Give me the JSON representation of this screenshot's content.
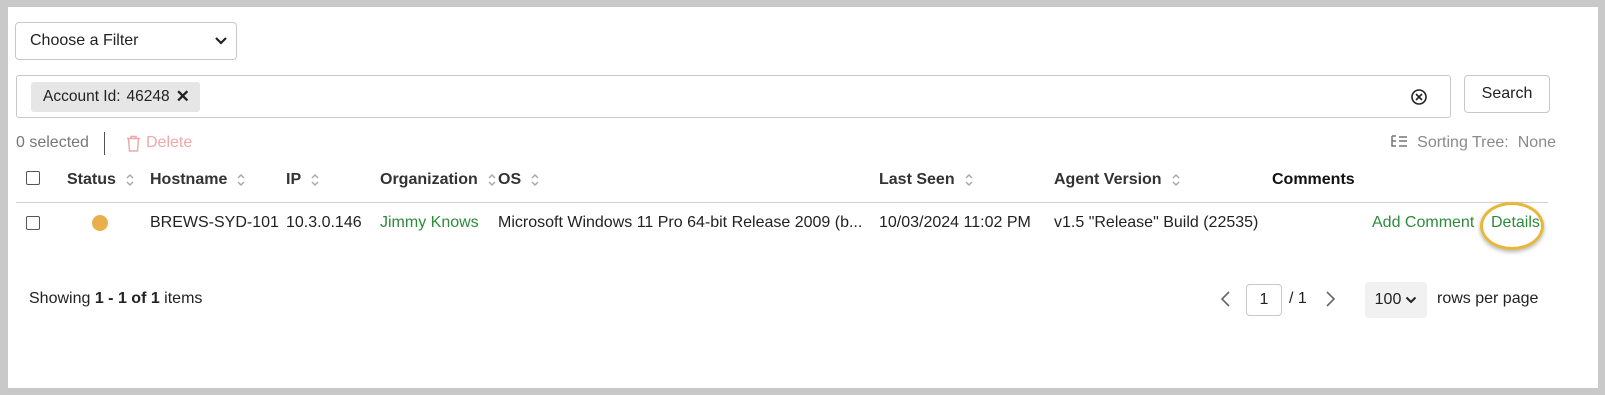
{
  "filter": {
    "label": "Choose a Filter"
  },
  "search": {
    "chip_key": "Account Id:",
    "chip_value": "46248",
    "button_label": "Search"
  },
  "toolbar": {
    "selected": "0 selected",
    "delete": "Delete",
    "sorting_label": "Sorting Tree:",
    "sorting_value": "None"
  },
  "table": {
    "columns": {
      "status": "Status",
      "hostname": "Hostname",
      "ip": "IP",
      "organization": "Organization",
      "os": "OS",
      "last_seen": "Last Seen",
      "agent_version": "Agent Version",
      "comments": "Comments"
    },
    "rows": [
      {
        "status_color": "#e8b04b",
        "hostname": "BREWS-SYD-101",
        "ip": "10.3.0.146",
        "organization": "Jimmy Knows",
        "os": "Microsoft Windows 11 Pro 64-bit Release 2009 (b...",
        "last_seen": "10/03/2024 11:02 PM",
        "agent_version": "v1.5 \"Release\" Build (22535)",
        "add_comment": "Add Comment",
        "details": "Details"
      }
    ]
  },
  "footer": {
    "showing_prefix": "Showing ",
    "range": "1 - 1 of 1",
    "items_suffix": " items",
    "page": "1",
    "total_pages": "/ 1",
    "rows_per_page": "100",
    "rows_label": "rows per page"
  },
  "colors": {
    "accent_green": "#2e8b3a",
    "highlight": "#e8b73a",
    "delete_disabled": "#f0a8a8"
  }
}
